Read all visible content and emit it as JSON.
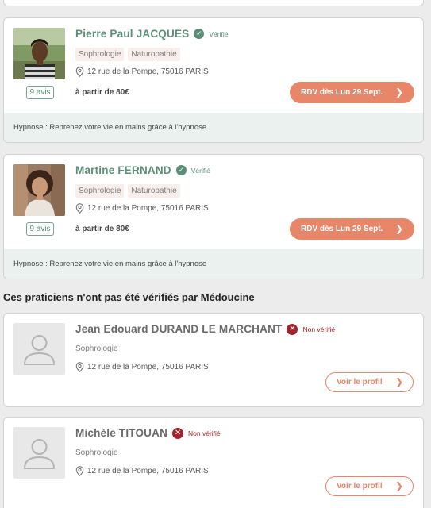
{
  "verified_practitioners": [
    {
      "name": "Pierre Paul JACQUES",
      "verified_label": "Vérifié",
      "tags": [
        "Sophrologie",
        "Naturopathie"
      ],
      "address": "12 rue de la Pompe, 75016 PARIS",
      "reviews": "9 avis",
      "price": "à partir de 80€",
      "cta": "RDV dès Lun 29 Sept.",
      "footer": "Hypnose : Reprenez votre vie en mains grâce à l'hypnose"
    },
    {
      "name": "Martine FERNAND",
      "verified_label": "Vérifié",
      "tags": [
        "Sophrologie",
        "Naturopathie"
      ],
      "address": "12 rue de la Pompe, 75016 PARIS",
      "reviews": "9 avis",
      "price": "à partir de 80€",
      "cta": "RDV dès Lun 29 Sept.",
      "footer": "Hypnose : Reprenez votre vie en mains grâce à l'hypnose"
    }
  ],
  "unverified_section_title": "Ces praticiens n'ont pas été vérifiés par Médoucine",
  "unverified_practitioners": [
    {
      "name": "Jean Edouard DURAND LE MARCHANT",
      "status_label": "Non vérifié",
      "specialty": "Sophrologie",
      "address": "12 rue de la Pompe, 75016 PARIS",
      "cta": "Voir le profil"
    },
    {
      "name": "Michèle TITOUAN",
      "status_label": "Non vérifié",
      "specialty": "Sophrologie",
      "address": "12 rue de la Pompe, 75016 PARIS",
      "cta": "Voir le profil"
    }
  ],
  "icons": {
    "verified": "check-circle-icon",
    "unverified": "x-circle-icon",
    "location": "map-pin-icon",
    "chevron": "chevron-right-icon",
    "avatar_placeholder": "user-silhouette-icon"
  },
  "colors": {
    "brand_green": "#5a8e76",
    "accent_orange": "#e8866a",
    "unverified_red": "#a4222a",
    "footer_bg": "#ebf1ee",
    "tag_bg": "#f8efec"
  }
}
